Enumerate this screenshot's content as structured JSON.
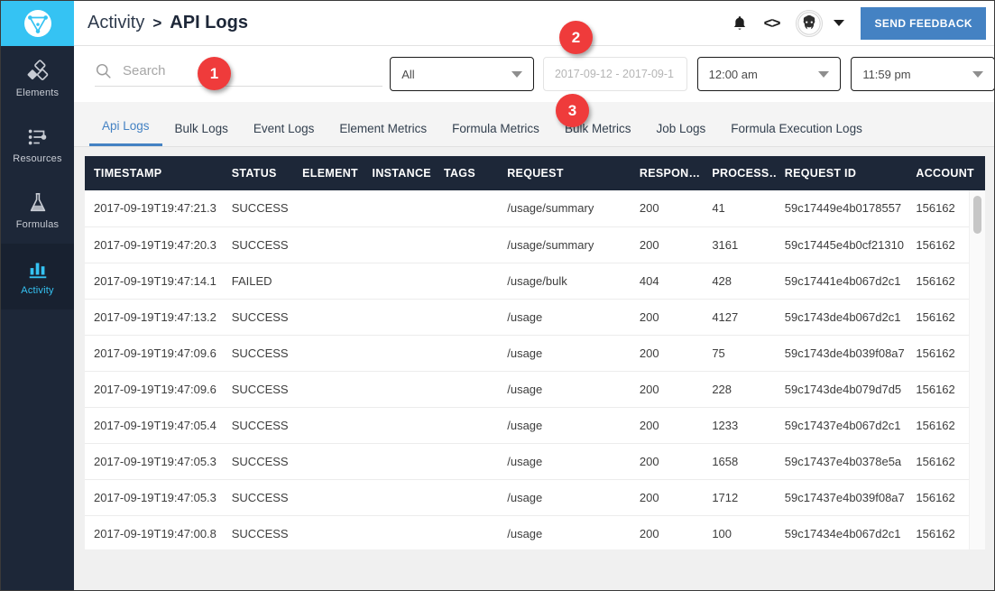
{
  "brand": {
    "logo_icon": "cloud-elements-logo",
    "accent_blue": "#35c3f3",
    "sidebar_bg": "#1d2738",
    "tab_active": "#4482c3",
    "badge_red": "#ef3b3b",
    "success_green": "#3fb984",
    "failed_red": "#f4533e"
  },
  "sidebar": {
    "items": [
      {
        "label": "Elements",
        "icon": "elements-icon",
        "active": false
      },
      {
        "label": "Resources",
        "icon": "resources-icon",
        "active": false
      },
      {
        "label": "Formulas",
        "icon": "formulas-icon",
        "active": false
      },
      {
        "label": "Activity",
        "icon": "activity-icon",
        "active": true
      }
    ]
  },
  "header": {
    "breadcrumb_parent": "Activity",
    "breadcrumb_separator": ">",
    "breadcrumb_current": "API Logs",
    "bell_icon": "notification-bell-icon",
    "code_icon": "<>",
    "avatar_icon": "user-avatar",
    "caret_icon": "chevron-down-icon",
    "feedback_label": "SEND FEEDBACK"
  },
  "filters": {
    "search_placeholder": "Search",
    "search_value": "",
    "search_icon": "search-icon",
    "type_filter_value": "All",
    "date_range_placeholder": "2017-09-12 - 2017-09-1",
    "time_from_value": "12:00 am",
    "time_to_value": "11:59 pm"
  },
  "tabs": [
    {
      "label": "Api Logs",
      "active": true
    },
    {
      "label": "Bulk Logs",
      "active": false
    },
    {
      "label": "Event Logs",
      "active": false
    },
    {
      "label": "Element Metrics",
      "active": false
    },
    {
      "label": "Formula Metrics",
      "active": false
    },
    {
      "label": "Bulk Metrics",
      "active": false
    },
    {
      "label": "Job Logs",
      "active": false
    },
    {
      "label": "Formula Execution Logs",
      "active": false
    }
  ],
  "table": {
    "columns": [
      "TIMESTAMP",
      "STATUS",
      "ELEMENT",
      "INSTANCE",
      "TAGS",
      "REQUEST",
      "RESPON…",
      "PROCESS…",
      "REQUEST ID",
      "ACCOUNT"
    ],
    "rows": [
      {
        "timestamp": "2017-09-19T19:47:21.3",
        "status": "SUCCESS",
        "element": "",
        "instance": "",
        "tags": "",
        "request": "/usage/summary",
        "response": "200",
        "processing": "41",
        "request_id": "59c17449e4b0178557",
        "account": "156162"
      },
      {
        "timestamp": "2017-09-19T19:47:20.3",
        "status": "SUCCESS",
        "element": "",
        "instance": "",
        "tags": "",
        "request": "/usage/summary",
        "response": "200",
        "processing": "3161",
        "request_id": "59c17445e4b0cf21310",
        "account": "156162"
      },
      {
        "timestamp": "2017-09-19T19:47:14.1",
        "status": "FAILED",
        "element": "",
        "instance": "",
        "tags": "",
        "request": "/usage/bulk",
        "response": "404",
        "processing": "428",
        "request_id": "59c17441e4b067d2c1",
        "account": "156162"
      },
      {
        "timestamp": "2017-09-19T19:47:13.2",
        "status": "SUCCESS",
        "element": "",
        "instance": "",
        "tags": "",
        "request": "/usage",
        "response": "200",
        "processing": "4127",
        "request_id": "59c1743de4b067d2c1",
        "account": "156162"
      },
      {
        "timestamp": "2017-09-19T19:47:09.6",
        "status": "SUCCESS",
        "element": "",
        "instance": "",
        "tags": "",
        "request": "/usage",
        "response": "200",
        "processing": "75",
        "request_id": "59c1743de4b039f08a7",
        "account": "156162"
      },
      {
        "timestamp": "2017-09-19T19:47:09.6",
        "status": "SUCCESS",
        "element": "",
        "instance": "",
        "tags": "",
        "request": "/usage",
        "response": "200",
        "processing": "228",
        "request_id": "59c1743de4b079d7d5",
        "account": "156162"
      },
      {
        "timestamp": "2017-09-19T19:47:05.4",
        "status": "SUCCESS",
        "element": "",
        "instance": "",
        "tags": "",
        "request": "/usage",
        "response": "200",
        "processing": "1233",
        "request_id": "59c17437e4b067d2c1",
        "account": "156162"
      },
      {
        "timestamp": "2017-09-19T19:47:05.3",
        "status": "SUCCESS",
        "element": "",
        "instance": "",
        "tags": "",
        "request": "/usage",
        "response": "200",
        "processing": "1658",
        "request_id": "59c17437e4b0378e5a",
        "account": "156162"
      },
      {
        "timestamp": "2017-09-19T19:47:05.3",
        "status": "SUCCESS",
        "element": "",
        "instance": "",
        "tags": "",
        "request": "/usage",
        "response": "200",
        "processing": "1712",
        "request_id": "59c17437e4b039f08a7",
        "account": "156162"
      },
      {
        "timestamp": "2017-09-19T19:47:00.8",
        "status": "SUCCESS",
        "element": "",
        "instance": "",
        "tags": "",
        "request": "/usage",
        "response": "200",
        "processing": "100",
        "request_id": "59c17434e4b067d2c1",
        "account": "156162"
      }
    ]
  },
  "badges": [
    {
      "label": "1"
    },
    {
      "label": "2"
    },
    {
      "label": "3"
    }
  ]
}
